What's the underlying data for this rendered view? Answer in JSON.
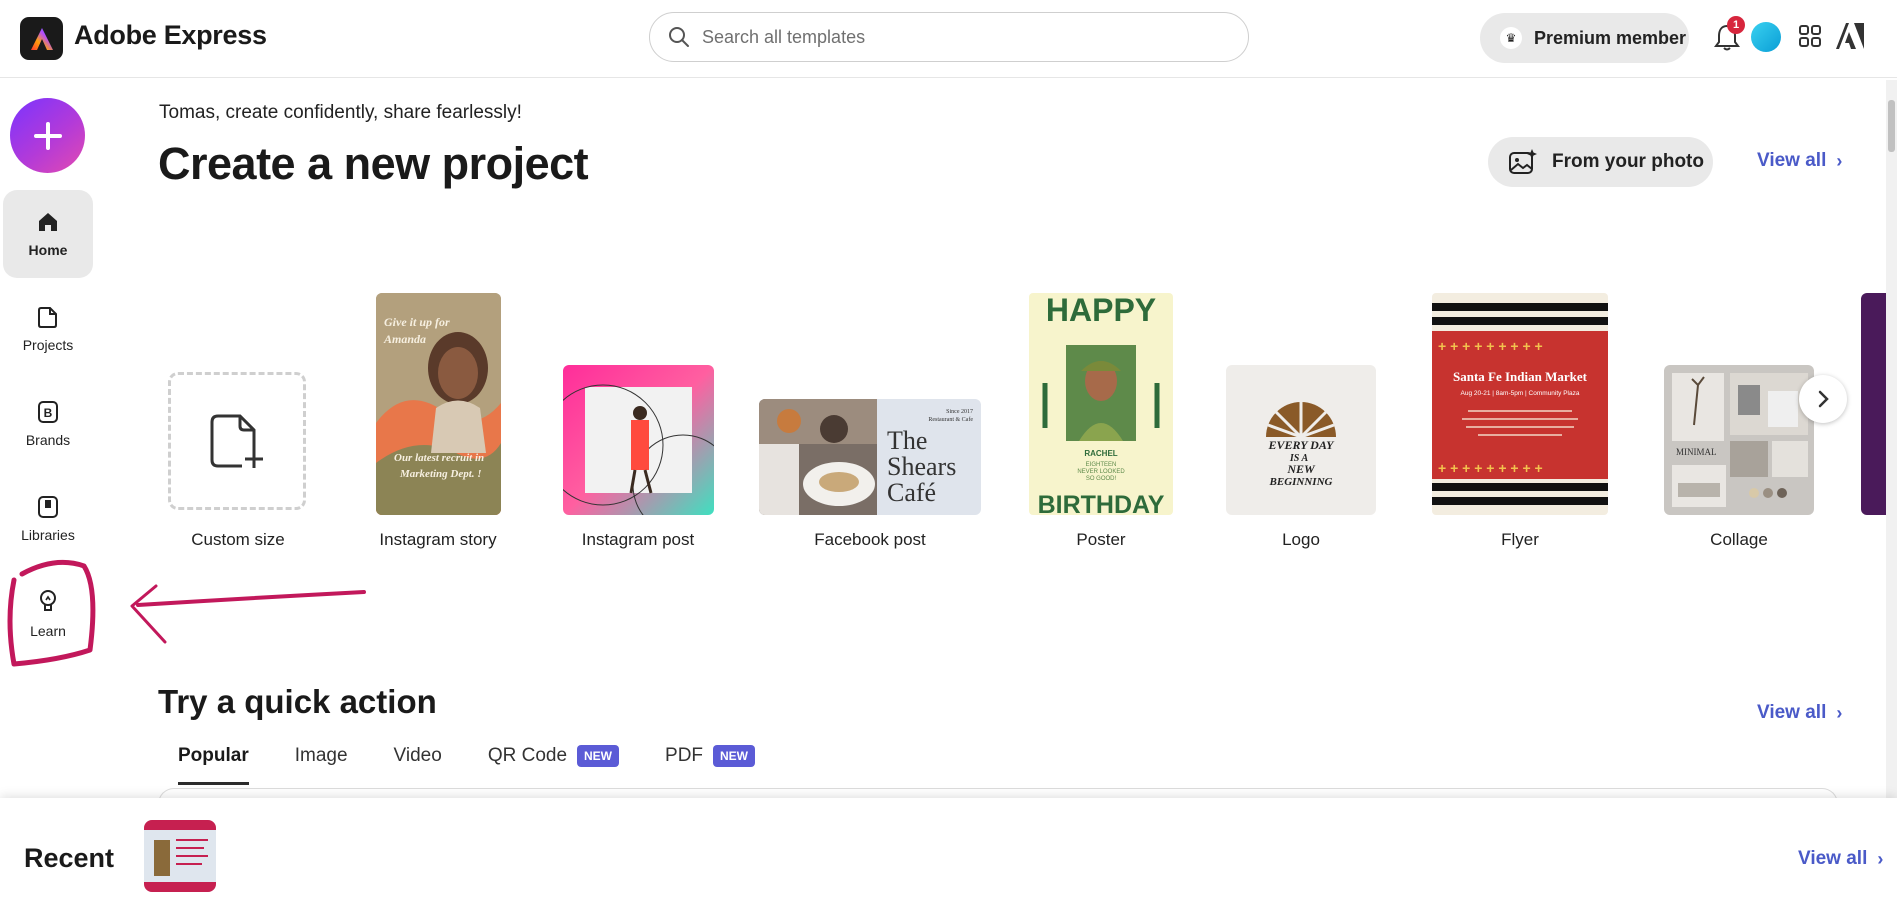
{
  "app": {
    "name": "Adobe Express"
  },
  "search": {
    "placeholder": "Search all templates"
  },
  "header": {
    "premium_label": "Premium member",
    "notification_count": "1"
  },
  "sidebar": {
    "items": [
      {
        "label": "Home",
        "icon": "home-icon",
        "active": true
      },
      {
        "label": "Projects",
        "icon": "projects-icon"
      },
      {
        "label": "Brands",
        "icon": "brands-icon"
      },
      {
        "label": "Libraries",
        "icon": "libraries-icon"
      },
      {
        "label": "Learn",
        "icon": "lightbulb-icon"
      }
    ]
  },
  "main": {
    "greeting": "Tomas, create confidently, share fearlessly!",
    "create_title": "Create a new project",
    "from_photo_label": "From your photo",
    "view_all": "View all",
    "templates": [
      {
        "label": "Custom size"
      },
      {
        "label": "Instagram story",
        "text_top": "Give it up for Amanda",
        "text_bottom": "Our latest recruit in Marketing Dept. !"
      },
      {
        "label": "Instagram post"
      },
      {
        "label": "Facebook post",
        "text": [
          "The",
          "Shears",
          "Café"
        ],
        "small": "Since 2017 Restaurant & Cafe"
      },
      {
        "label": "Poster",
        "text_top": "HAPPY",
        "text_bottom": "BIRTHDAY",
        "name": "RACHEL",
        "sub": "EIGHTEEN NEVER LOOKED SO GOOD!"
      },
      {
        "label": "Logo",
        "text": [
          "EVERY DAY",
          "IS A",
          "NEW",
          "BEGINNING"
        ]
      },
      {
        "label": "Flyer",
        "title": "Santa Fe Indian Market",
        "sub": "Aug 20-21 | 8am-5pm | Community Plaza"
      },
      {
        "label": "Collage",
        "text": "MINIMAL"
      }
    ],
    "quick_title": "Try a quick action",
    "quick_view_all": "View all",
    "tabs": [
      {
        "label": "Popular",
        "active": true
      },
      {
        "label": "Image"
      },
      {
        "label": "Video"
      },
      {
        "label": "QR Code",
        "badge": "NEW"
      },
      {
        "label": "PDF",
        "badge": "NEW"
      }
    ]
  },
  "recent": {
    "title": "Recent",
    "view_all": "View all"
  },
  "colors": {
    "accent_link": "#4a5ac8",
    "badge_new": "#5b5bd6",
    "annotation": "#c2185b"
  }
}
